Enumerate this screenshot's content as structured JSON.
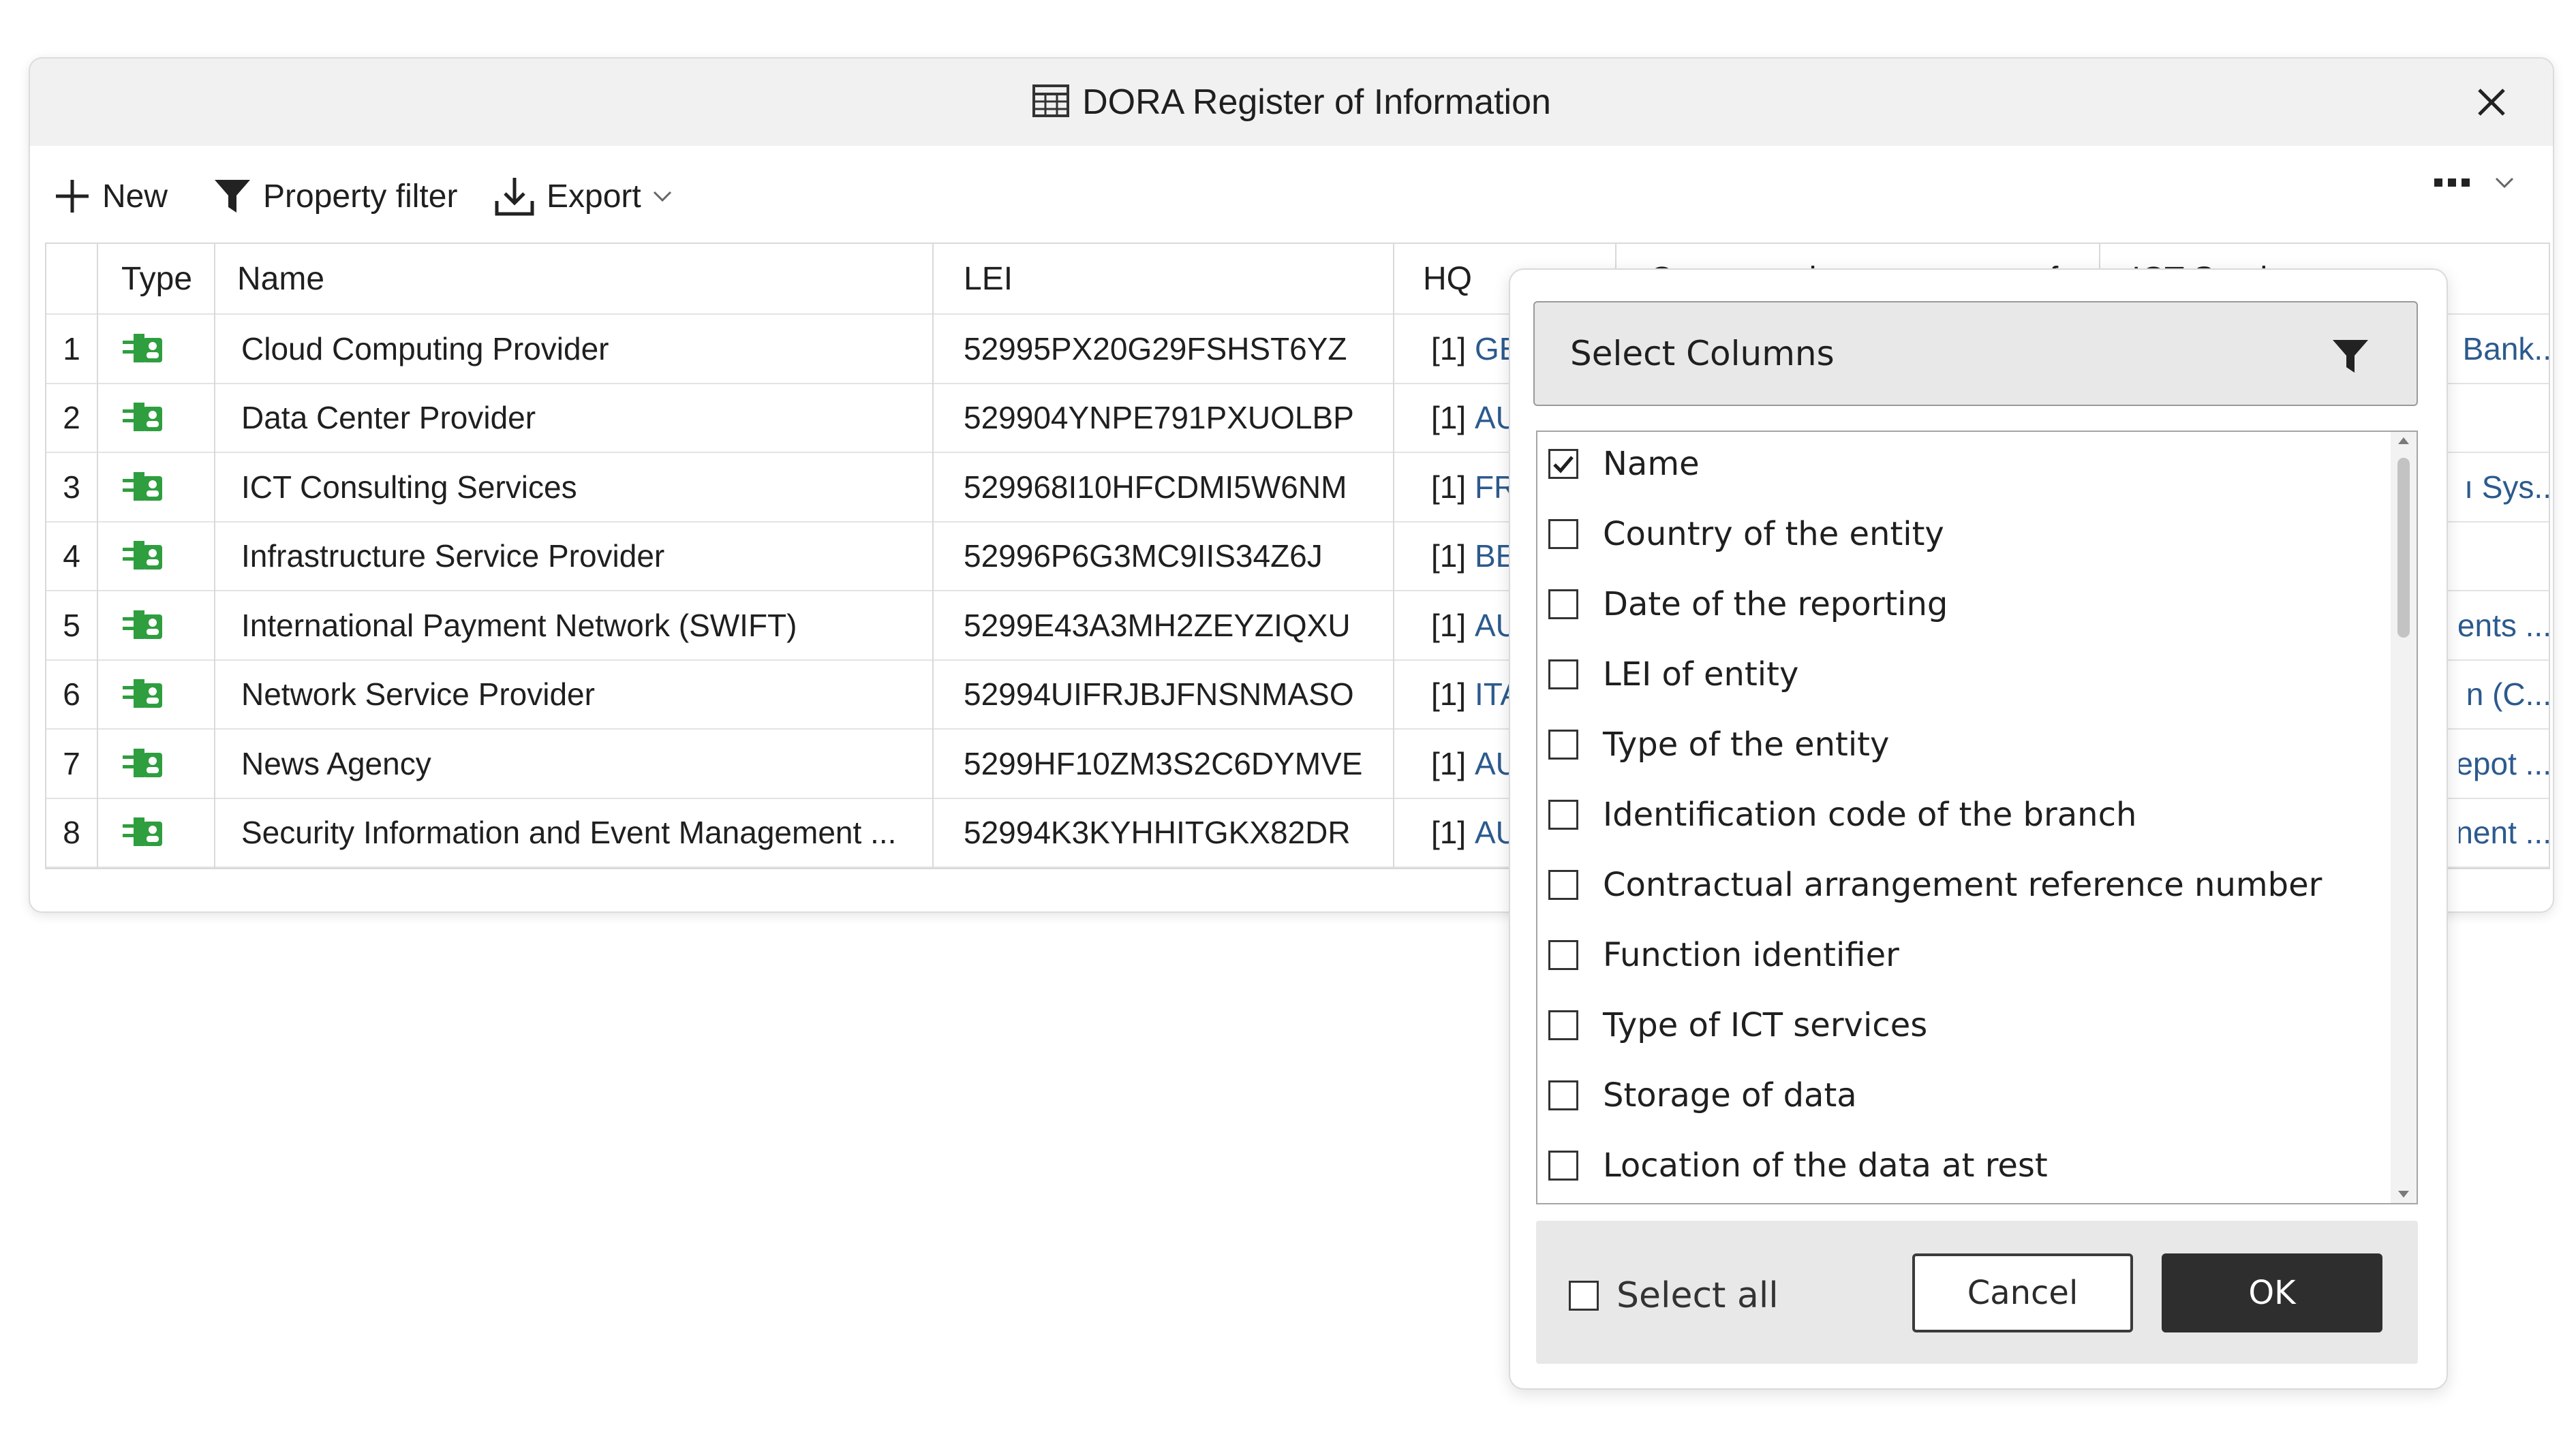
{
  "window": {
    "title": "DORA Register of Information"
  },
  "toolbar": {
    "new_label": "New",
    "property_filter_label": "Property filter",
    "export_label": "Export"
  },
  "table": {
    "columns": [
      "Type",
      "Name",
      "LEI",
      "HQ",
      "Contractual arrangement ref...",
      "ICT Services"
    ],
    "rows": [
      {
        "num": "1",
        "name": "Cloud Computing Provider",
        "lei": "52995PX20G29FSHST6YZ",
        "hq_prefix": "[1]",
        "hq_link": "GEI",
        "right_text": "Bank.."
      },
      {
        "num": "2",
        "name": "Data Center Provider",
        "lei": "529904YNPE791PXUOLBP",
        "hq_prefix": "[1]",
        "hq_link": "AUT",
        "right_text": ""
      },
      {
        "num": "3",
        "name": "ICT Consulting Services",
        "lei": "529968I10HFCDMI5W6NM",
        "hq_prefix": "[1]",
        "hq_link": "FRA",
        "right_text": "ı Sys.."
      },
      {
        "num": "4",
        "name": "Infrastructure Service Provider",
        "lei": "52996P6G3MC9IIS34Z6J",
        "hq_prefix": "[1]",
        "hq_link": "BEL",
        "right_text": ""
      },
      {
        "num": "5",
        "name": "International Payment Network (SWIFT)",
        "lei": "5299E43A3MH2ZEYZIQXU",
        "hq_prefix": "[1]",
        "hq_link": "AUT",
        "right_text": "ents ..."
      },
      {
        "num": "6",
        "name": "Network Service Provider",
        "lei": "52994UIFRJBJFNSNMASO",
        "hq_prefix": "[1]",
        "hq_link": "ITA",
        "right_text": "n (C..."
      },
      {
        "num": "7",
        "name": "News Agency",
        "lei": "5299HF10ZM3S2C6DYMVE",
        "hq_prefix": "[1]",
        "hq_link": "AUT",
        "right_text": "epot ..."
      },
      {
        "num": "8",
        "name": "Security Information and Event Management ...",
        "lei": "52994K3KYHHITGKX82DR",
        "hq_prefix": "[1]",
        "hq_link": "AUT",
        "right_text": "nent ..."
      }
    ]
  },
  "popup": {
    "header": "Select Columns",
    "items": [
      {
        "label": "Name",
        "checked": true
      },
      {
        "label": "Country of the entity",
        "checked": false
      },
      {
        "label": "Date of the reporting",
        "checked": false
      },
      {
        "label": "LEI of entity",
        "checked": false
      },
      {
        "label": "Type of the entity",
        "checked": false
      },
      {
        "label": "Identification code of the branch",
        "checked": false
      },
      {
        "label": "Contractual arrangement reference number",
        "checked": false
      },
      {
        "label": "Function identifier",
        "checked": false
      },
      {
        "label": "Type of ICT services",
        "checked": false
      },
      {
        "label": "Storage of data",
        "checked": false
      },
      {
        "label": "Location of the data at rest",
        "checked": false
      }
    ],
    "select_all_label": "Select all",
    "cancel_label": "Cancel",
    "ok_label": "OK"
  },
  "colors": {
    "accent_link": "#2c5a8e",
    "type_icon_green": "#2e9e3f",
    "ok_button_bg": "#2e2e2e"
  }
}
